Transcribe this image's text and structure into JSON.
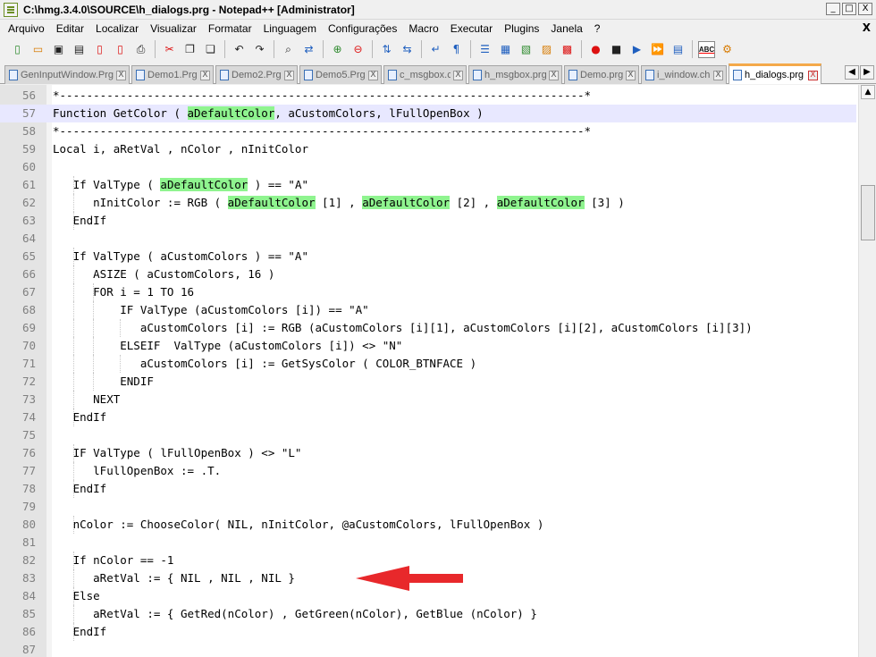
{
  "window": {
    "title": "C:\\hmg.3.4.0\\SOURCE\\h_dialogs.prg - Notepad++ [Administrator]",
    "controls": [
      "_",
      "□",
      "X"
    ]
  },
  "menu": [
    "Arquivo",
    "Editar",
    "Localizar",
    "Visualizar",
    "Formatar",
    "Linguagem",
    "Configurações",
    "Macro",
    "Executar",
    "Plugins",
    "Janela",
    "?"
  ],
  "menu_close": "X",
  "toolbar": {
    "icons": [
      "new-file-icon",
      "open-file-icon",
      "save-icon",
      "save-all-icon",
      "close-icon",
      "close-all-icon",
      "print-icon",
      "cut-icon",
      "copy-icon",
      "paste-icon",
      "undo-icon",
      "redo-icon",
      "find-icon",
      "replace-icon",
      "zoom-in-icon",
      "zoom-out-icon",
      "sync-v-icon",
      "sync-h-icon",
      "word-wrap-icon",
      "show-all-chars-icon",
      "indent-guide-icon",
      "doc-map-icon",
      "function-list-icon",
      "folder-workspace-icon",
      "record-macro-icon",
      "stop-record-icon",
      "play-macro-icon",
      "run-macro-multiple-icon",
      "save-macro-icon",
      "spell-check-icon",
      "plugin-icon"
    ],
    "spell_label": "ABC"
  },
  "tabs": [
    {
      "label": "GenInputWindow.Prg",
      "active": false
    },
    {
      "label": "Demo1.Prg",
      "active": false
    },
    {
      "label": "Demo2.Prg",
      "active": false
    },
    {
      "label": "Demo5.Prg",
      "active": false
    },
    {
      "label": "c_msgbox.c",
      "active": false
    },
    {
      "label": "h_msgbox.prg",
      "active": false
    },
    {
      "label": "Demo.prg",
      "active": false
    },
    {
      "label": "i_window.ch",
      "active": false
    },
    {
      "label": "h_dialogs.prg",
      "active": true
    }
  ],
  "tab_close": "X",
  "tab_scroll": [
    "◀",
    "▶"
  ],
  "editor": {
    "current_line": 57,
    "lines": [
      {
        "n": "56",
        "code": "*------------------------------------------------------------------------------*"
      },
      {
        "n": "57",
        "code": "Function GetColor ( aDefaultColor, aCustomColors, lFullOpenBox )"
      },
      {
        "n": "58",
        "code": "*------------------------------------------------------------------------------*"
      },
      {
        "n": "59",
        "code": "Local i, aRetVal , nColor , nInitColor"
      },
      {
        "n": "60",
        "code": ""
      },
      {
        "n": "61",
        "code": "   If ValType ( aDefaultColor ) == \"A\""
      },
      {
        "n": "62",
        "code": "      nInitColor := RGB ( aDefaultColor [1] , aDefaultColor [2] , aDefaultColor [3] )"
      },
      {
        "n": "63",
        "code": "   EndIf"
      },
      {
        "n": "64",
        "code": ""
      },
      {
        "n": "65",
        "code": "   If ValType ( aCustomColors ) == \"A\""
      },
      {
        "n": "66",
        "code": "      ASIZE ( aCustomColors, 16 )"
      },
      {
        "n": "67",
        "code": "      FOR i = 1 TO 16"
      },
      {
        "n": "68",
        "code": "          IF ValType (aCustomColors [i]) == \"A\""
      },
      {
        "n": "69",
        "code": "             aCustomColors [i] := RGB (aCustomColors [i][1], aCustomColors [i][2], aCustomColors [i][3])"
      },
      {
        "n": "70",
        "code": "          ELSEIF  ValType (aCustomColors [i]) <> \"N\""
      },
      {
        "n": "71",
        "code": "             aCustomColors [i] := GetSysColor ( COLOR_BTNFACE )"
      },
      {
        "n": "72",
        "code": "          ENDIF"
      },
      {
        "n": "73",
        "code": "      NEXT"
      },
      {
        "n": "74",
        "code": "   EndIf"
      },
      {
        "n": "75",
        "code": ""
      },
      {
        "n": "76",
        "code": "   IF ValType ( lFullOpenBox ) <> \"L\""
      },
      {
        "n": "77",
        "code": "      lFullOpenBox := .T."
      },
      {
        "n": "78",
        "code": "   EndIf"
      },
      {
        "n": "79",
        "code": ""
      },
      {
        "n": "80",
        "code": "   nColor := ChooseColor( NIL, nInitColor, @aCustomColors, lFullOpenBox )"
      },
      {
        "n": "81",
        "code": ""
      },
      {
        "n": "82",
        "code": "   If nColor == -1"
      },
      {
        "n": "83",
        "code": "      aRetVal := { NIL , NIL , NIL }"
      },
      {
        "n": "84",
        "code": "   Else"
      },
      {
        "n": "85",
        "code": "      aRetVal := { GetRed(nColor) , GetGreen(nColor), GetBlue (nColor) }"
      },
      {
        "n": "86",
        "code": "   EndIf"
      },
      {
        "n": "87",
        "code": ""
      }
    ],
    "highlight_term": "aDefaultColor"
  },
  "colors": {
    "highlight": "#8ff48f",
    "current_line": "#e8e8ff",
    "active_tab_accent": "#f4a94a",
    "annotation_arrow": "#e8282b"
  },
  "annotation": {
    "arrow_points_to_line": 83
  }
}
